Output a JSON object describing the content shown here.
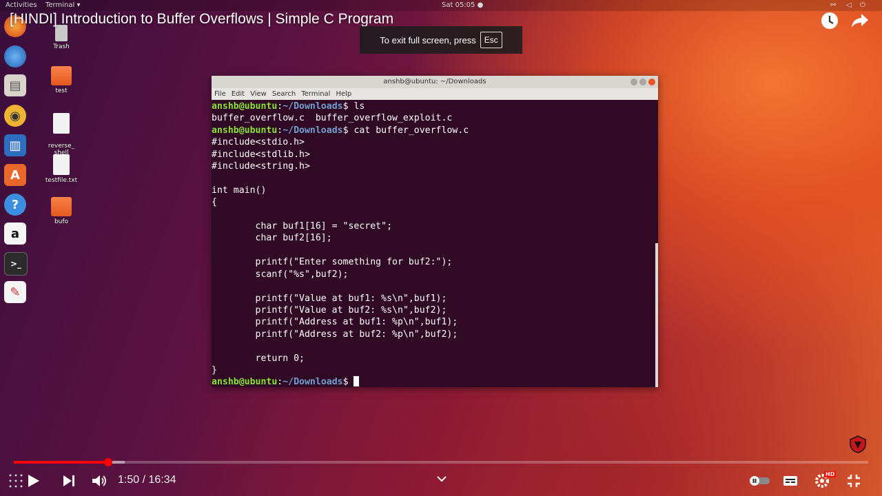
{
  "topbar": {
    "activities": "Activities",
    "app_menu": "Terminal ▾",
    "clock": "Sat 05:05 ●"
  },
  "video": {
    "title": "[HINDI] Introduction to Buffer Overflows | Simple C Program",
    "fullscreen_hint": "To exit full screen, press",
    "fullscreen_key": "Esc"
  },
  "desktop": {
    "icons": [
      {
        "label": "Trash"
      },
      {
        "label": "test"
      },
      {
        "label": "reverse_\nshell"
      },
      {
        "label": "testfile.txt"
      },
      {
        "label": "bufo"
      }
    ]
  },
  "dock": {
    "items": [
      "firefox-icon",
      "thunderbird-icon",
      "files-icon",
      "rhythmbox-icon",
      "writer-icon",
      "software-icon",
      "help-icon",
      "amazon-icon",
      "terminal-icon",
      "text-editor-icon"
    ]
  },
  "terminal": {
    "title": "anshb@ubuntu: ~/Downloads",
    "menu": [
      "File",
      "Edit",
      "View",
      "Search",
      "Terminal",
      "Help"
    ],
    "user": "anshb@ubuntu",
    "path": "~/Downloads",
    "cmd1": "ls",
    "ls_output": "buffer_overflow.c  buffer_overflow_exploit.c",
    "cmd2": "cat buffer_overflow.c",
    "source": "#include<stdio.h>\n#include<stdlib.h>\n#include<string.h>\n\nint main()\n{\n\n        char buf1[16] = \"secret\";\n        char buf2[16];\n\n        printf(\"Enter something for buf2:\");\n        scanf(\"%s\",buf2);\n\n        printf(\"Value at buf1: %s\\n\",buf1);\n        printf(\"Value at buf2: %s\\n\",buf2);\n        printf(\"Address at buf1: %p\\n\",buf1);\n        printf(\"Address at buf2: %p\\n\",buf2);\n\n        return 0;\n}"
  },
  "player": {
    "current_time": "1:50",
    "duration": "16:34",
    "time_display": "1:50 / 16:34",
    "progress_fraction": 0.1107,
    "buffered_fraction": 0.13,
    "quality_badge": "HD",
    "accent_color": "#ff0000"
  }
}
